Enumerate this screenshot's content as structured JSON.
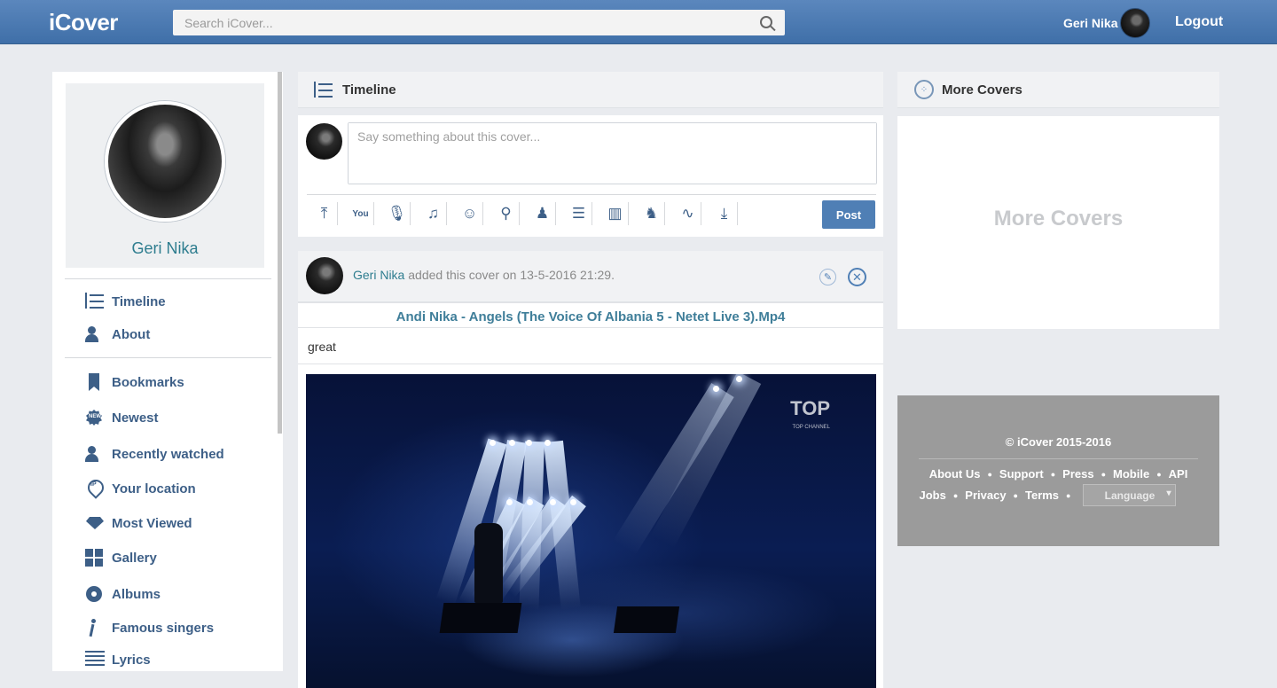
{
  "app": {
    "logo": "iCover"
  },
  "search": {
    "placeholder": "Search iCover..."
  },
  "user": {
    "name": "Geri Nika",
    "logout": "Logout"
  },
  "sidebar": {
    "profile_name": "Geri Nika",
    "items": [
      {
        "label": "Timeline",
        "icon": "timeline-icon"
      },
      {
        "label": "About",
        "icon": "user-icon"
      },
      {
        "label": "Bookmarks",
        "icon": "bookmark-icon"
      },
      {
        "label": "Newest",
        "icon": "new-badge-icon"
      },
      {
        "label": "Recently watched",
        "icon": "user-clock-icon"
      },
      {
        "label": "Your location",
        "icon": "location-pin-icon"
      },
      {
        "label": "Most Viewed",
        "icon": "diamond-icon"
      },
      {
        "label": "Gallery",
        "icon": "grid-icon"
      },
      {
        "label": "Albums",
        "icon": "disc-icon"
      },
      {
        "label": "Famous singers",
        "icon": "singer-icon"
      },
      {
        "label": "Lyrics",
        "icon": "lines-icon"
      }
    ]
  },
  "timeline": {
    "title": "Timeline",
    "composer_placeholder": "Say something about this cover...",
    "post_button": "Post",
    "tools": [
      "upload-icon",
      "youtube-icon",
      "microphone-icon",
      "music-list-icon",
      "smile-icon",
      "tag-icon",
      "user-upload-icon",
      "sheet-icon",
      "piano-icon",
      "singer-icon",
      "share-icon",
      "download-icon"
    ]
  },
  "post": {
    "author": "Geri Nika",
    "meta": " added this cover on 13-5-2016 21:29.",
    "title": "Andi Nika - Angels (The Voice Of Albania 5 - Netet Live 3).Mp4",
    "text": "great",
    "video_channel": "TOP",
    "video_channel_sub": "TOP CHANNEL"
  },
  "more_covers": {
    "title": "More Covers",
    "placeholder": "More Covers"
  },
  "footer": {
    "copyright": "© iCover 2015-2016",
    "links_row1": [
      "About Us",
      "Support",
      "Press",
      "Mobile",
      "API"
    ],
    "links_row2": [
      "Jobs",
      "Privacy",
      "Terms"
    ],
    "language": "Language"
  }
}
